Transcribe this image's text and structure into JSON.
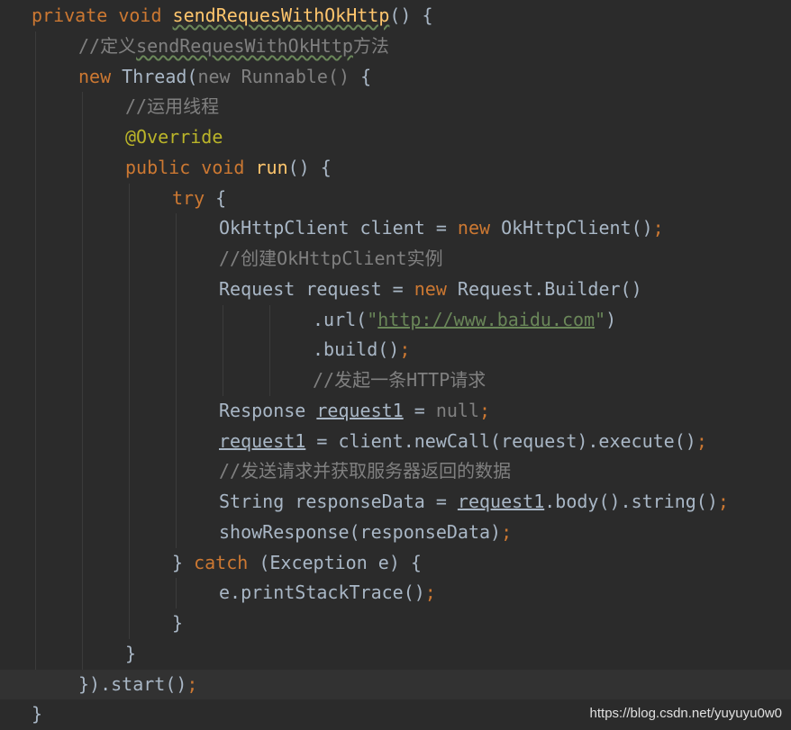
{
  "code_lines": [
    {
      "indent": 0,
      "tokens": [
        {
          "t": "private void ",
          "c": "kw"
        },
        {
          "t": "sendRequesWithOkHttp",
          "c": "fn typo"
        },
        {
          "t": "() {",
          "c": "plain"
        }
      ]
    },
    {
      "indent": 1,
      "tokens": [
        {
          "t": "//定义",
          "c": "cmt"
        },
        {
          "t": "sendRequesWithOkHttp",
          "c": "cmt typo"
        },
        {
          "t": "方法",
          "c": "cmt"
        }
      ]
    },
    {
      "indent": 1,
      "tokens": [
        {
          "t": "new ",
          "c": "kw"
        },
        {
          "t": "Thread(",
          "c": "plain"
        },
        {
          "t": "new Runnable() ",
          "c": "dim"
        },
        {
          "t": "{",
          "c": "plain"
        }
      ]
    },
    {
      "indent": 2,
      "tokens": [
        {
          "t": "//运用线程",
          "c": "cmt"
        }
      ]
    },
    {
      "indent": 2,
      "tokens": [
        {
          "t": "@Override",
          "c": "ann"
        }
      ]
    },
    {
      "indent": 2,
      "tokens": [
        {
          "t": "public void ",
          "c": "kw"
        },
        {
          "t": "run",
          "c": "fn"
        },
        {
          "t": "() {",
          "c": "plain"
        }
      ]
    },
    {
      "indent": 3,
      "tokens": [
        {
          "t": "try ",
          "c": "kw"
        },
        {
          "t": "{",
          "c": "plain"
        }
      ]
    },
    {
      "indent": 4,
      "tokens": [
        {
          "t": "OkHttpClient client = ",
          "c": "plain"
        },
        {
          "t": "new ",
          "c": "kw"
        },
        {
          "t": "OkHttpClient()",
          "c": "plain"
        },
        {
          "t": ";",
          "c": "semi"
        }
      ]
    },
    {
      "indent": 4,
      "tokens": [
        {
          "t": "//创建OkHttpClient实例",
          "c": "cmt"
        }
      ]
    },
    {
      "indent": 4,
      "tokens": [
        {
          "t": "Request request = ",
          "c": "plain"
        },
        {
          "t": "new ",
          "c": "kw"
        },
        {
          "t": "Request.Builder()",
          "c": "plain"
        }
      ]
    },
    {
      "indent": 6,
      "tokens": [
        {
          "t": ".url(",
          "c": "plain"
        },
        {
          "t": "\"",
          "c": "str"
        },
        {
          "t": "http://www.baidu.com",
          "c": "link"
        },
        {
          "t": "\"",
          "c": "str"
        },
        {
          "t": ")",
          "c": "plain"
        }
      ]
    },
    {
      "indent": 6,
      "tokens": [
        {
          "t": ".build()",
          "c": "plain"
        },
        {
          "t": ";",
          "c": "semi"
        }
      ]
    },
    {
      "indent": 6,
      "tokens": [
        {
          "t": "//发起一条HTTP请求",
          "c": "cmt"
        }
      ]
    },
    {
      "indent": 4,
      "tokens": [
        {
          "t": "Response ",
          "c": "plain"
        },
        {
          "t": "request1",
          "c": "ul"
        },
        {
          "t": " = ",
          "c": "plain"
        },
        {
          "t": "null",
          "c": "dim"
        },
        {
          "t": ";",
          "c": "semi"
        }
      ]
    },
    {
      "indent": 4,
      "tokens": [
        {
          "t": "request1",
          "c": "ul"
        },
        {
          "t": " = client.newCall(request).execute()",
          "c": "plain"
        },
        {
          "t": ";",
          "c": "semi"
        }
      ]
    },
    {
      "indent": 4,
      "tokens": [
        {
          "t": "//发送请求并获取服务器返回的数据",
          "c": "cmt"
        }
      ]
    },
    {
      "indent": 4,
      "tokens": [
        {
          "t": "String responseData = ",
          "c": "plain"
        },
        {
          "t": "request1",
          "c": "ul"
        },
        {
          "t": ".body().string()",
          "c": "plain"
        },
        {
          "t": ";",
          "c": "semi"
        }
      ]
    },
    {
      "indent": 4,
      "tokens": [
        {
          "t": "showResponse(responseData)",
          "c": "plain"
        },
        {
          "t": ";",
          "c": "semi"
        }
      ]
    },
    {
      "indent": 3,
      "tokens": [
        {
          "t": "} ",
          "c": "plain"
        },
        {
          "t": "catch ",
          "c": "kw"
        },
        {
          "t": "(Exception e) {",
          "c": "plain"
        }
      ]
    },
    {
      "indent": 4,
      "tokens": [
        {
          "t": "e.printStackTrace()",
          "c": "plain"
        },
        {
          "t": ";",
          "c": "semi"
        }
      ]
    },
    {
      "indent": 3,
      "tokens": [
        {
          "t": "}",
          "c": "plain"
        }
      ]
    },
    {
      "indent": 2,
      "tokens": [
        {
          "t": "}",
          "c": "plain"
        }
      ]
    },
    {
      "indent": 1,
      "current": true,
      "tokens": [
        {
          "t": "}).start()",
          "c": "plain"
        },
        {
          "t": ";",
          "c": "semi"
        }
      ]
    },
    {
      "indent": 0,
      "tokens": [
        {
          "t": "}",
          "c": "plain"
        }
      ]
    }
  ],
  "watermark": "https://blog.csdn.net/yuyuyu0w0",
  "colors": {
    "background": "#2b2b2b",
    "keyword": "#cc7832",
    "method": "#ffc66d",
    "text": "#a9b7c6",
    "comment": "#808080",
    "annotation": "#bbb529",
    "string": "#6a8759"
  }
}
